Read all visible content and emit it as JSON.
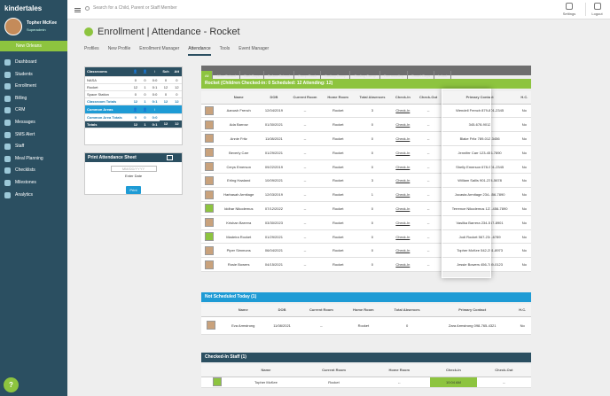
{
  "brand": "kindertales",
  "user": {
    "name": "Topher McKee",
    "role": "Superadmin"
  },
  "school": "New Orleans",
  "nav": [
    "Dashboard",
    "Students",
    "Enrollment",
    "Billing",
    "CRM",
    "Messages",
    "SMS Alert",
    "Staff",
    "Meal Planning",
    "Checklists",
    "Milestones",
    "Analytics"
  ],
  "help": "?",
  "search_placeholder": "Search for a Child, Parent or Staff Member",
  "top": {
    "settings": "Settings",
    "logout": "Logout"
  },
  "page": {
    "title": "Enrollment  |  Attendance - Rocket"
  },
  "subtabs": [
    "Profiles",
    "New Profile",
    "Enrollment Manager",
    "Attendance",
    "Tools",
    "Event Manager"
  ],
  "classrooms": {
    "title": "Classrooms",
    "cols": [
      "",
      "👤",
      "👤",
      "↕",
      "Sch",
      "Att"
    ],
    "rows": [
      [
        "NASA",
        "0",
        "0",
        "0:0",
        "0",
        "0"
      ],
      [
        "Rocket",
        "12",
        "1",
        "0:1",
        "12",
        "12"
      ],
      [
        "Space Station",
        "0",
        "0",
        "0:0",
        "0",
        "0"
      ]
    ],
    "total": [
      "Classroom Totals",
      "12",
      "1",
      "0:1",
      "12",
      "12"
    ]
  },
  "common": {
    "title": "Common Areas",
    "total": [
      "Common Area Totals",
      "0",
      "0",
      "0:0"
    ],
    "grand": [
      "Totals",
      "12",
      "1",
      "0:1",
      "12",
      "12"
    ]
  },
  "print": {
    "title": "Print Attendance Sheet",
    "placeholder": "MM/DD/YYYY",
    "label": "Enter Date",
    "btn": "Print"
  },
  "filters": [
    "All",
    "After School",
    "Bad Guys",
    "Before School",
    "Camp Rock",
    "Coding Camp",
    "Coding Camp",
    "Fun meeting",
    "Smart Guys",
    "Infant"
  ],
  "rocket": {
    "header": "Rocket (Children Checked-in: 0   Scheduled: 12   Attending: 12)",
    "cols": [
      "",
      "Name",
      "DOB",
      "Current Room",
      "Home Room",
      "Total Absences",
      "Check-In",
      "Check-Out",
      "Primary Contact",
      "H.C."
    ],
    "rows": [
      [
        "Aanush French",
        "12/04/2019",
        "--",
        "Rocket",
        "3",
        "Check-In",
        "--",
        "Wendell French 879-801-2345",
        "No"
      ],
      [
        "Ada Barrow",
        "01/30/2021",
        "--",
        "Rocket",
        "0",
        "Check-In",
        "--",
        "345-678-9012",
        "No"
      ],
      [
        "Annie Fritz",
        "11/08/2021",
        "--",
        "Rocket",
        "0",
        "Check-In",
        "--",
        "Blake Fritz 789-012-3456",
        "No"
      ],
      [
        "Beverly Carr",
        "01/29/2021",
        "--",
        "Rocket",
        "0",
        "Check-In",
        "--",
        "Jennifer Carr 123-456-7890",
        "No"
      ],
      [
        "Cerys Emerson",
        "09/22/2019",
        "--",
        "Rocket",
        "0",
        "Check-In",
        "--",
        "Shelly Emerson 678-901-2345",
        "No"
      ],
      [
        "Erling Haaland",
        "10/09/2021",
        "--",
        "Rocket",
        "3",
        "Check-In",
        "--",
        "William Sallis 901-234-5678",
        "No"
      ],
      [
        "Harbasah Armitage",
        "12/03/2019",
        "--",
        "Rocket",
        "1",
        "Check-In",
        "--",
        "Jocasta Armitage 234-456-7890",
        "No"
      ],
      [
        "Iddhar Nikodemus",
        "07/12/2022",
        "--",
        "Rocket",
        "0",
        "Check-In",
        "--",
        "Terrence Nikodemus 123-456-7890",
        "No"
      ],
      [
        "Krishan Barrera",
        "03/30/2023",
        "--",
        "Rocket",
        "0",
        "Check-In",
        "--",
        "Vasilka Barrera 234-567-8901",
        "No"
      ],
      [
        "Madeira Rocket",
        "01/29/2021",
        "--",
        "Rocket",
        "0",
        "Check-In",
        "--",
        "Jodi Rocket 567-234-6789",
        "No"
      ],
      [
        "Piper Simmons",
        "06/04/2021",
        "--",
        "Rocket",
        "0",
        "Check-In",
        "--",
        "Topher McKee 542-251-8973",
        "No"
      ],
      [
        "Rosie Bowers",
        "04/15/2021",
        "--",
        "Rocket",
        "0",
        "Check-In",
        "--",
        "Jessie Bowers 456-789-0123",
        "No"
      ]
    ]
  },
  "notsched": {
    "header": "Not Scheduled Today (1)",
    "cols": [
      "",
      "Name",
      "DOB",
      "Current Room",
      "Home Room",
      "Total Absences",
      "Primary Contact",
      "H.C."
    ],
    "rows": [
      [
        "Eva Armstrong",
        "11/08/2021",
        "--",
        "Rocket",
        "0",
        "Zara Armstrong 098-765-4321",
        "No"
      ]
    ]
  },
  "staff": {
    "header": "Checked-In Staff (1)",
    "cols": [
      "",
      "Name",
      "Current Room",
      "Home Room",
      "Check-In",
      "Check-Out"
    ],
    "rows": [
      [
        "Topher McKee",
        "Rocket",
        "--",
        "10:04 AM",
        "--"
      ]
    ]
  }
}
